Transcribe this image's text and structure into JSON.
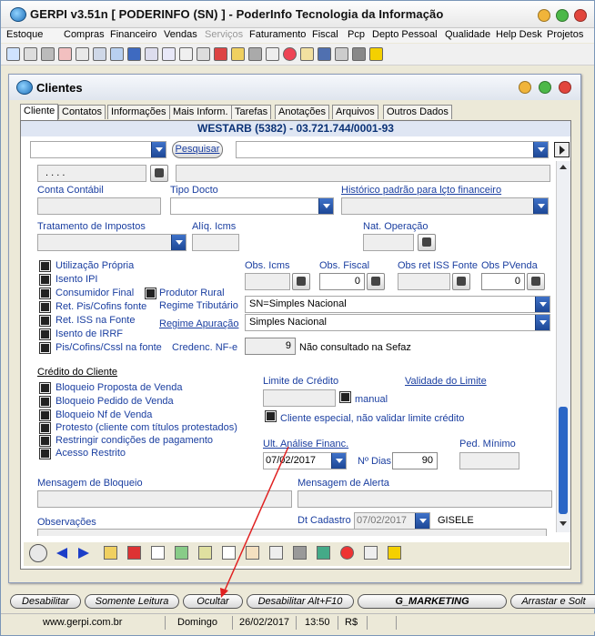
{
  "app": {
    "title": "GERPI v3.51n  [ PODERINFO (SN) ] - PoderInfo Tecnologia da Informação",
    "menu": [
      "Estoque",
      "Compras",
      "Financeiro",
      "Vendas",
      "Serviços",
      "Faturamento",
      "Fiscal",
      "Pcp",
      "Depto Pessoal",
      "Qualidade",
      "Help Desk",
      "Projetos"
    ]
  },
  "window": {
    "title": "Clientes",
    "tabs": [
      "Cliente",
      "Contatos",
      "Informações",
      "Mais Inform.",
      "Tarefas",
      "Anotações",
      "Arquivos",
      "Outros Dados"
    ],
    "header": "WESTARB  (5382) - 03.721.744/0001-93",
    "search_button": "Pesquisar"
  },
  "form": {
    "masked_field": ". . . .",
    "conta_contabil": "Conta Contábil",
    "tipo_docto": "Tipo Docto",
    "historico": "Histórico padrão para lçto financeiro",
    "tratamento": "Tratamento de Impostos",
    "aliq_icms": "Alíq. Icms",
    "nat_operacao": "Nat. Operação",
    "checks": [
      "Utilização Própria",
      "Isento IPI",
      "Consumidor Final",
      "Ret. Pis/Cofins fonte",
      "Ret. ISS na Fonte",
      "Isento de IRRF",
      "Pis/Cofins/Cssl na fonte"
    ],
    "produtor_rural": "Produtor Rural",
    "obs_icms": "Obs. Icms",
    "obs_fiscal": "Obs. Fiscal",
    "obs_fiscal_value": "0",
    "obs_ret_iss": "Obs ret ISS Fonte",
    "obs_pvenda": "Obs PVenda",
    "obs_pvenda_value": "0",
    "regime_tributario_label": "Regime Tributário",
    "regime_tributario_value": "SN=Simples Nacional",
    "regime_apuracao_label": "Regime Apuração",
    "regime_apuracao_value": "Simples Nacional",
    "credenc_label": "Credenc. NF-e",
    "credenc_value": "9",
    "credenc_status": "Não consultado na Sefaz",
    "credito_title": "Crédito do Cliente",
    "credito_checks": [
      "Bloqueio Proposta de Venda",
      "Bloqueio Pedido de Venda",
      "Bloqueio Nf de Venda",
      "Protesto (cliente com títulos protestados)",
      "Restringir condições de pagamento",
      "Acesso Restrito"
    ],
    "limite_credito": "Limite de Crédito",
    "validade_limite": "Validade do Limite",
    "manual": "manual",
    "cliente_especial": "Cliente especial, não validar limite crédito",
    "ult_analise": "Ult. Análise Financ.",
    "ult_analise_value": "07/02/2017",
    "n_dias": "Nº Dias",
    "n_dias_value": "90",
    "ped_minimo": "Ped. Mínimo",
    "msg_bloqueio": "Mensagem de Bloqueio",
    "msg_alerta": "Mensagem de Alerta",
    "observacoes": "Observações",
    "dt_cadastro": "Dt Cadastro",
    "dt_cadastro_value": "07/02/2017",
    "user": "GISELE"
  },
  "status_buttons": [
    "Desabilitar",
    "Somente Leitura",
    "Ocultar",
    "Desabilitar Alt+F10",
    "G_MARKETING",
    "Arrastar e Solt"
  ],
  "footer": {
    "site": "www.gerpi.com.br",
    "day": "Domingo",
    "date": "26/02/2017",
    "time": "13:50",
    "currency": "R$"
  },
  "colors": {
    "link": "#1a3ea0",
    "header_bg": "#dfe6f3",
    "arrow": "#e02020"
  }
}
